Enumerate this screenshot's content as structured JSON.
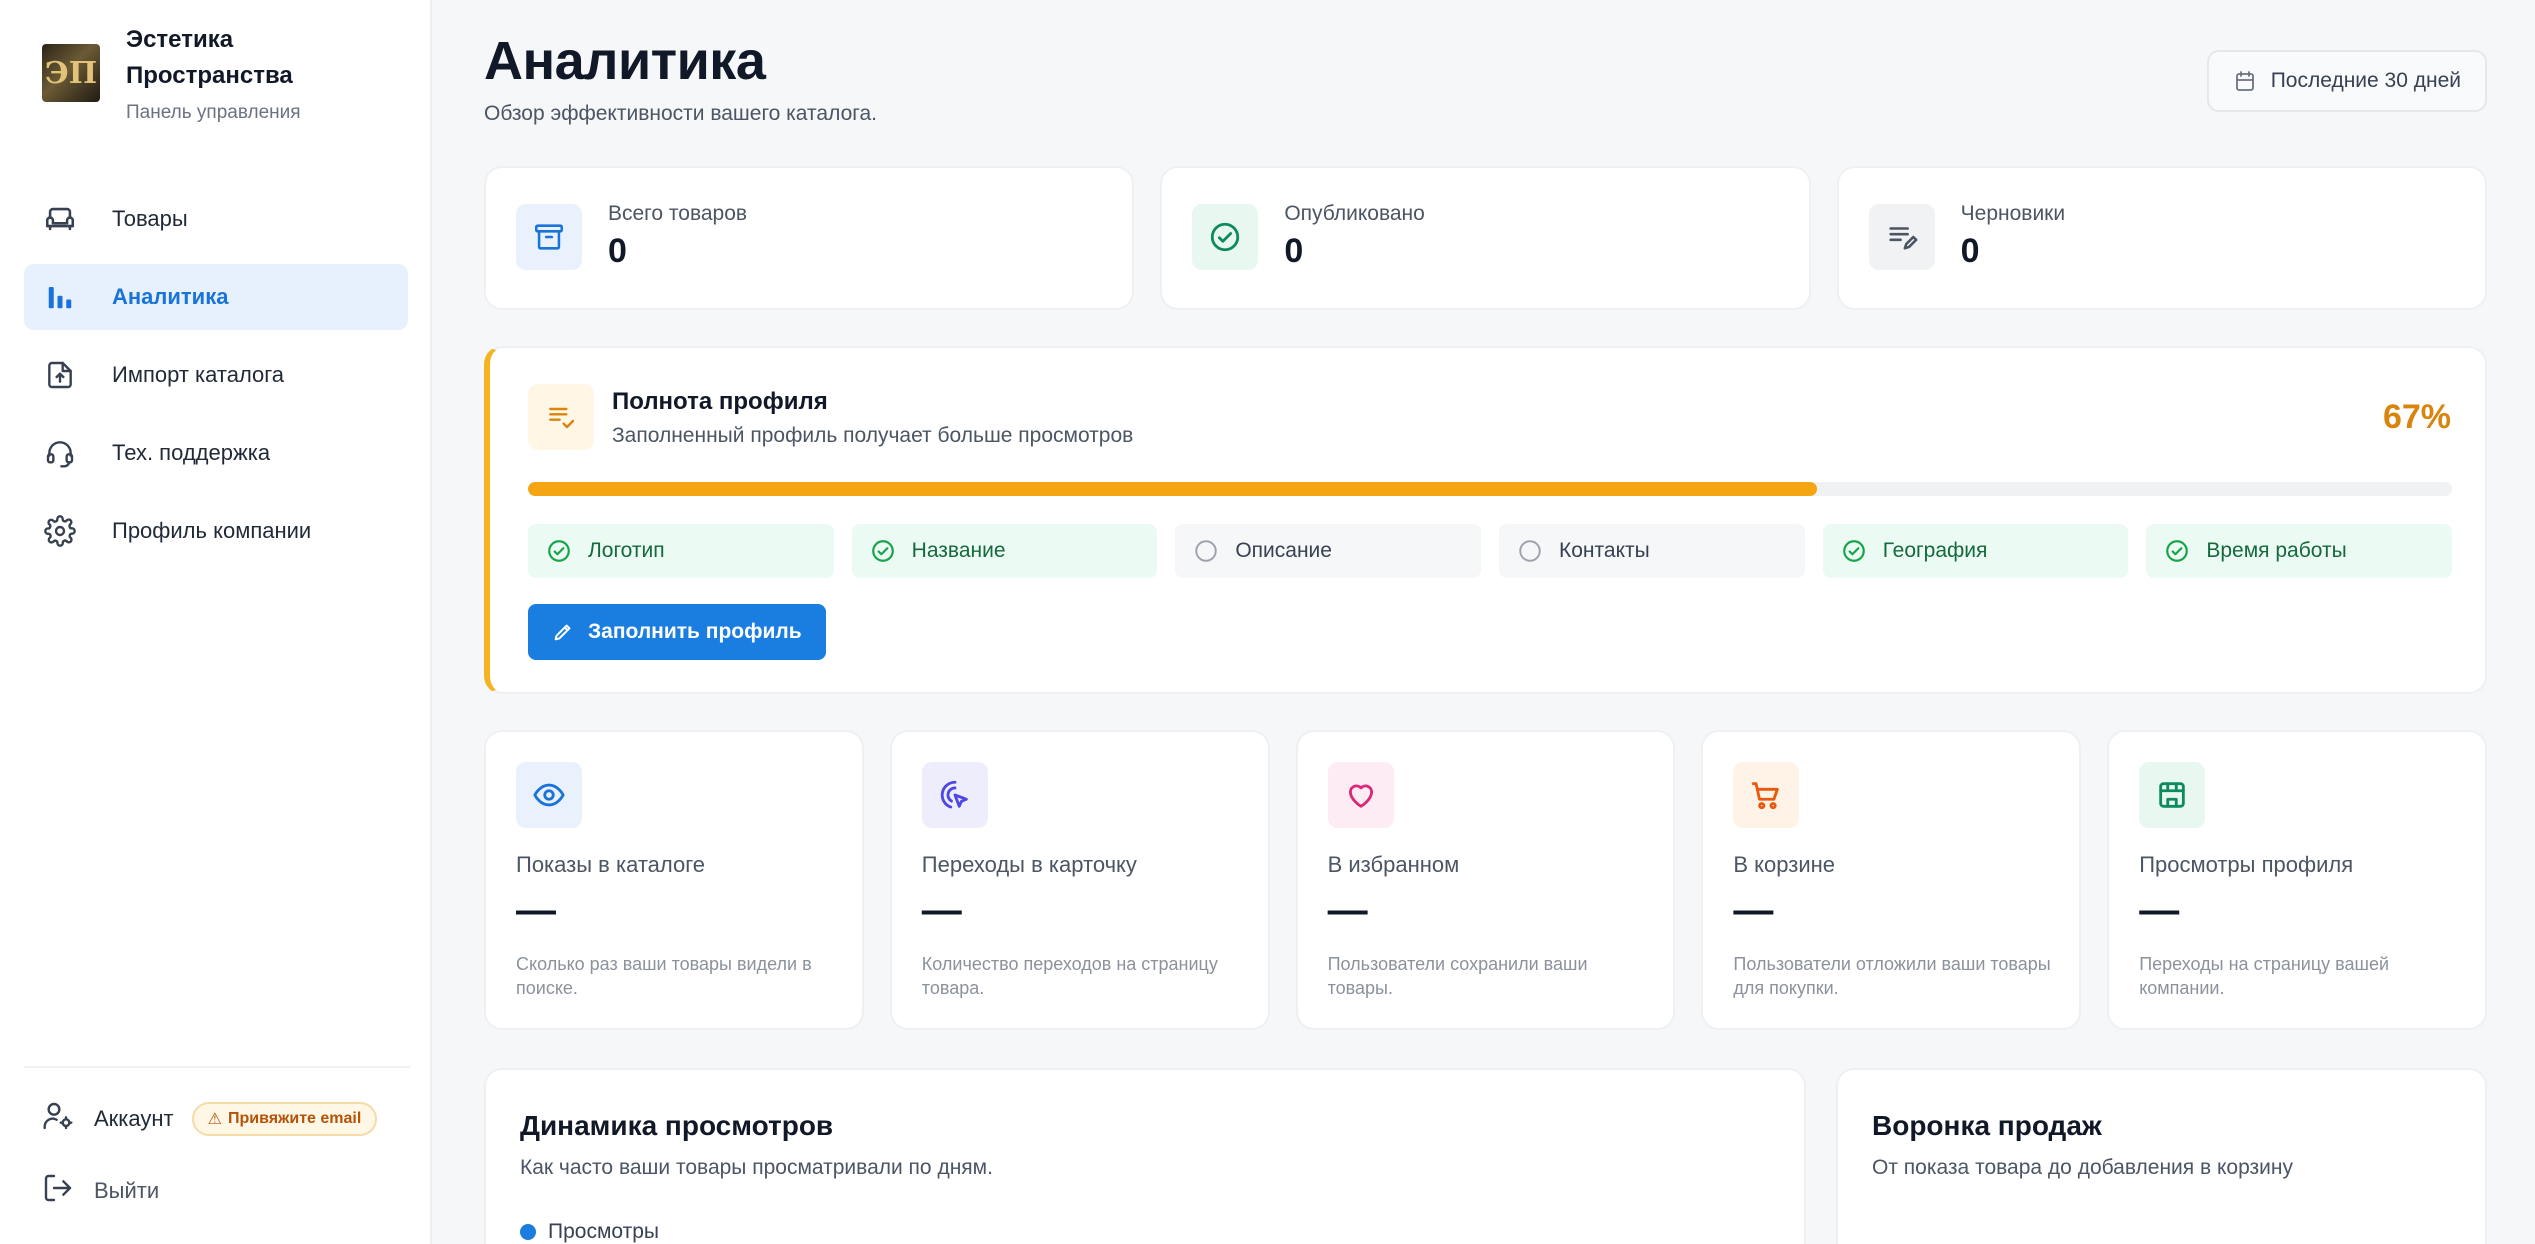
{
  "brand": {
    "name": "Эстетика Пространства",
    "subtitle": "Панель управления",
    "logo_text": "ЭП"
  },
  "sidebar": {
    "items": [
      {
        "label": "Товары",
        "icon": "sofa-icon",
        "active": false
      },
      {
        "label": "Аналитика",
        "icon": "bar-chart-icon",
        "active": true
      },
      {
        "label": "Импорт каталога",
        "icon": "file-upload-icon",
        "active": false
      },
      {
        "label": "Тех. поддержка",
        "icon": "headset-icon",
        "active": false
      },
      {
        "label": "Профиль компании",
        "icon": "gear-icon",
        "active": false
      }
    ],
    "account_label": "Аккаунт",
    "email_badge": "Привяжите email",
    "logout_label": "Выйти"
  },
  "header": {
    "title": "Аналитика",
    "subtitle": "Обзор эффективности вашего каталога.",
    "date_range": "Последние 30 дней"
  },
  "stats": [
    {
      "label": "Всего товаров",
      "value": "0",
      "icon": "archive-box-icon",
      "color": "#1a73d9",
      "bg": "#e8f1fc"
    },
    {
      "label": "Опубликовано",
      "value": "0",
      "icon": "check-circle-icon",
      "color": "#0f8a5f",
      "bg": "#e8f8f0"
    },
    {
      "label": "Черновики",
      "value": "0",
      "icon": "draft-edit-icon",
      "color": "#4b5563",
      "bg": "#f1f2f4"
    }
  ],
  "profile": {
    "title": "Полнота профиля",
    "subtitle": "Заполненный профиль получает больше просмотров",
    "percent_label": "67%",
    "percent": 67,
    "items": [
      {
        "label": "Логотип",
        "done": true
      },
      {
        "label": "Название",
        "done": true
      },
      {
        "label": "Описание",
        "done": false
      },
      {
        "label": "Контакты",
        "done": false
      },
      {
        "label": "География",
        "done": true
      },
      {
        "label": "Время работы",
        "done": true
      }
    ],
    "button_label": "Заполнить профиль"
  },
  "metrics": [
    {
      "label": "Показы в каталоге",
      "value": "—",
      "desc": "Сколько раз ваши товары видели в поиске.",
      "icon": "eye-icon",
      "color": "#1a73d9",
      "bg": "#e8f1fc"
    },
    {
      "label": "Переходы в карточку",
      "value": "—",
      "desc": "Количество переходов на страницу товара.",
      "icon": "cursor-click-icon",
      "color": "#4f46e5",
      "bg": "#eeedfc"
    },
    {
      "label": "В избранном",
      "value": "—",
      "desc": "Пользователи сохранили ваши товары.",
      "icon": "heart-icon",
      "color": "#db2777",
      "bg": "#fdecf4"
    },
    {
      "label": "В корзине",
      "value": "—",
      "desc": "Пользователи отложили ваши товары для покупки.",
      "icon": "cart-icon",
      "color": "#ea580c",
      "bg": "#fff2e6"
    },
    {
      "label": "Просмотры профиля",
      "value": "—",
      "desc": "Переходы на страницу вашей компании.",
      "icon": "storefront-icon",
      "color": "#0f8a5f",
      "bg": "#e8f8f0"
    }
  ],
  "views_chart": {
    "title": "Динамика просмотров",
    "subtitle": "Как часто ваши товары просматривали по дням.",
    "legend": "Просмотры",
    "legend_color": "#1a7de0"
  },
  "funnel": {
    "title": "Воронка продаж",
    "subtitle": "От показа товара до добавления в корзину"
  }
}
